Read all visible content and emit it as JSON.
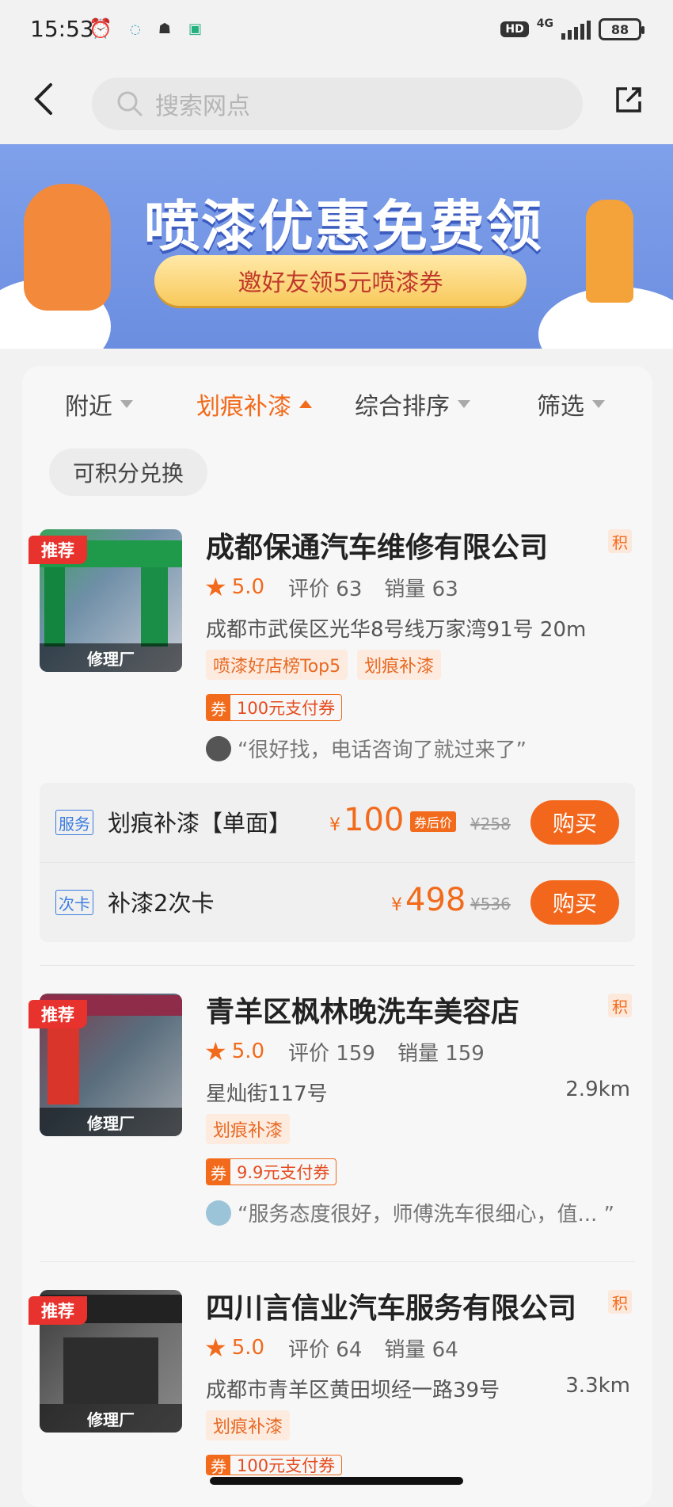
{
  "status_bar": {
    "time": "15:53",
    "network": "4G",
    "battery": "88"
  },
  "header": {
    "search_placeholder": "搜索网点"
  },
  "banner": {
    "headline": "喷漆优惠免费领",
    "subline": "邀好友领5元喷漆券"
  },
  "filters": [
    {
      "label": "附近"
    },
    {
      "label": "划痕补漆"
    },
    {
      "label": "综合排序"
    },
    {
      "label": "筛选"
    }
  ],
  "chip": "可积分兑换",
  "shops": [
    {
      "name": "成都保通汽车维修有限公司",
      "jf": "积",
      "rec": "推荐",
      "thumb_caption": "修理厂",
      "score": "5.0",
      "reviews": "评价 63",
      "sales": "销量 63",
      "address": "成都市武侯区光华8号线万家湾91号",
      "distance": "20m",
      "tags": [
        "喷漆好店榜Top5",
        "划痕补漆"
      ],
      "coupon_mark": "券",
      "coupon": "100元支付券",
      "review": "“很好找，电话咨询了就过来了”",
      "services": [
        {
          "badge": "服务",
          "name": "划痕补漆【单面】",
          "currency": "¥",
          "price": "100",
          "after": "券后价",
          "original": "¥258",
          "buy": "购买"
        },
        {
          "badge": "次卡",
          "name": "补漆2次卡",
          "currency": "¥",
          "price": "498",
          "original": "¥536",
          "buy": "购买"
        }
      ]
    },
    {
      "name": "青羊区枫林晚洗车美容店",
      "jf": "积",
      "rec": "推荐",
      "thumb_caption": "修理厂",
      "score": "5.0",
      "reviews": "评价 159",
      "sales": "销量 159",
      "address": "星灿街117号",
      "distance": "2.9km",
      "tags": [
        "划痕补漆"
      ],
      "coupon_mark": "券",
      "coupon": "9.9元支付券",
      "review": "“服务态度很好，师傅洗车很细心，值...  ”"
    },
    {
      "name": "四川言信业汽车服务有限公司",
      "jf": "积",
      "rec": "推荐",
      "thumb_caption": "修理厂",
      "score": "5.0",
      "reviews": "评价 64",
      "sales": "销量 64",
      "address": "成都市青羊区黄田坝经一路39号",
      "distance": "3.3km",
      "tags": [
        "划痕补漆"
      ],
      "coupon_mark": "券",
      "coupon": "100元支付券"
    }
  ]
}
